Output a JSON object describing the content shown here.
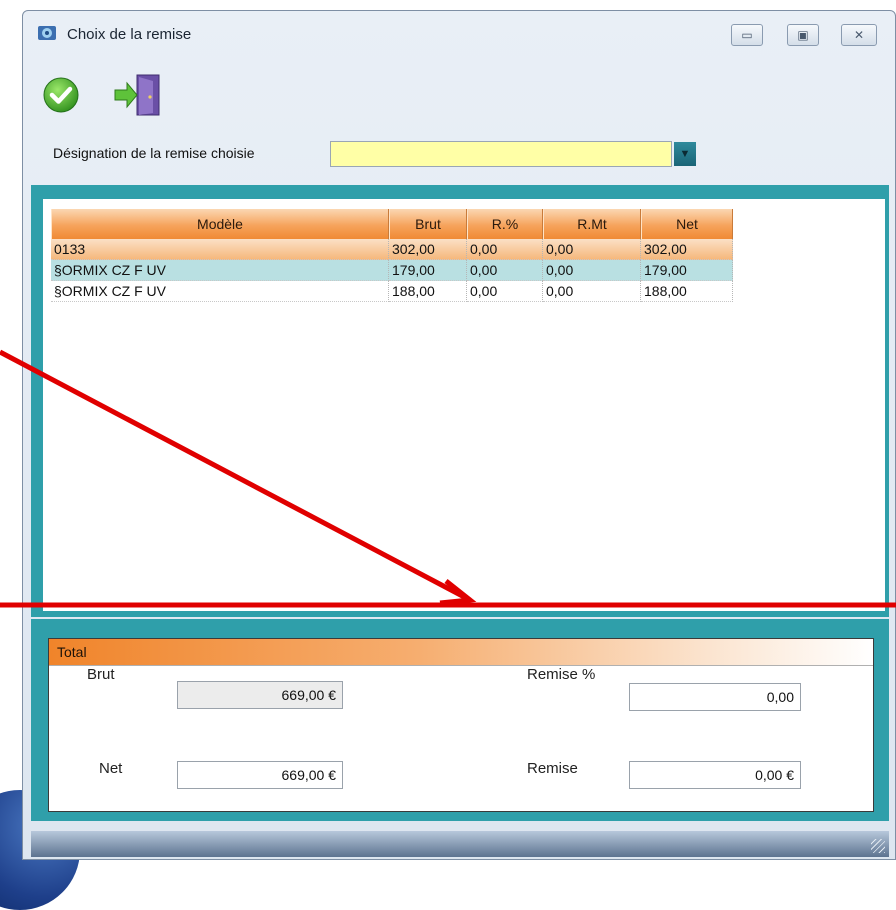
{
  "window": {
    "title": "Choix de la remise",
    "minimize_glyph": "▭",
    "maximize_glyph": "▣",
    "close_glyph": "✕"
  },
  "toolbar": {
    "validate_icon": "check-circle-icon",
    "exit_icon": "exit-door-icon"
  },
  "designation": {
    "label": "Désignation de la remise choisie",
    "value": "",
    "dropdown_glyph": "▼"
  },
  "grid": {
    "columns": [
      "Modèle",
      "Brut",
      "R.%",
      "R.Mt",
      "Net"
    ],
    "rows": [
      [
        "0133",
        "302,00",
        "0,00",
        "0,00",
        "302,00"
      ],
      [
        "§ORMIX CZ F UV",
        "179,00",
        "0,00",
        "0,00",
        "179,00"
      ],
      [
        "§ORMIX CZ F UV",
        "188,00",
        "0,00",
        "0,00",
        "188,00"
      ]
    ]
  },
  "total": {
    "header": "Total",
    "brut_label": "Brut",
    "brut_value": "669,00 €",
    "net_label": "Net",
    "net_value": "669,00 €",
    "remise_pct_label": "Remise %",
    "remise_pct_value": "0,00",
    "remise_label": "Remise",
    "remise_value": "0,00 €"
  },
  "colors": {
    "accent_teal": "#2f9faa",
    "header_orange": "#f08a34",
    "input_yellow": "#ffffa6",
    "annotation_red": "#e00000"
  }
}
